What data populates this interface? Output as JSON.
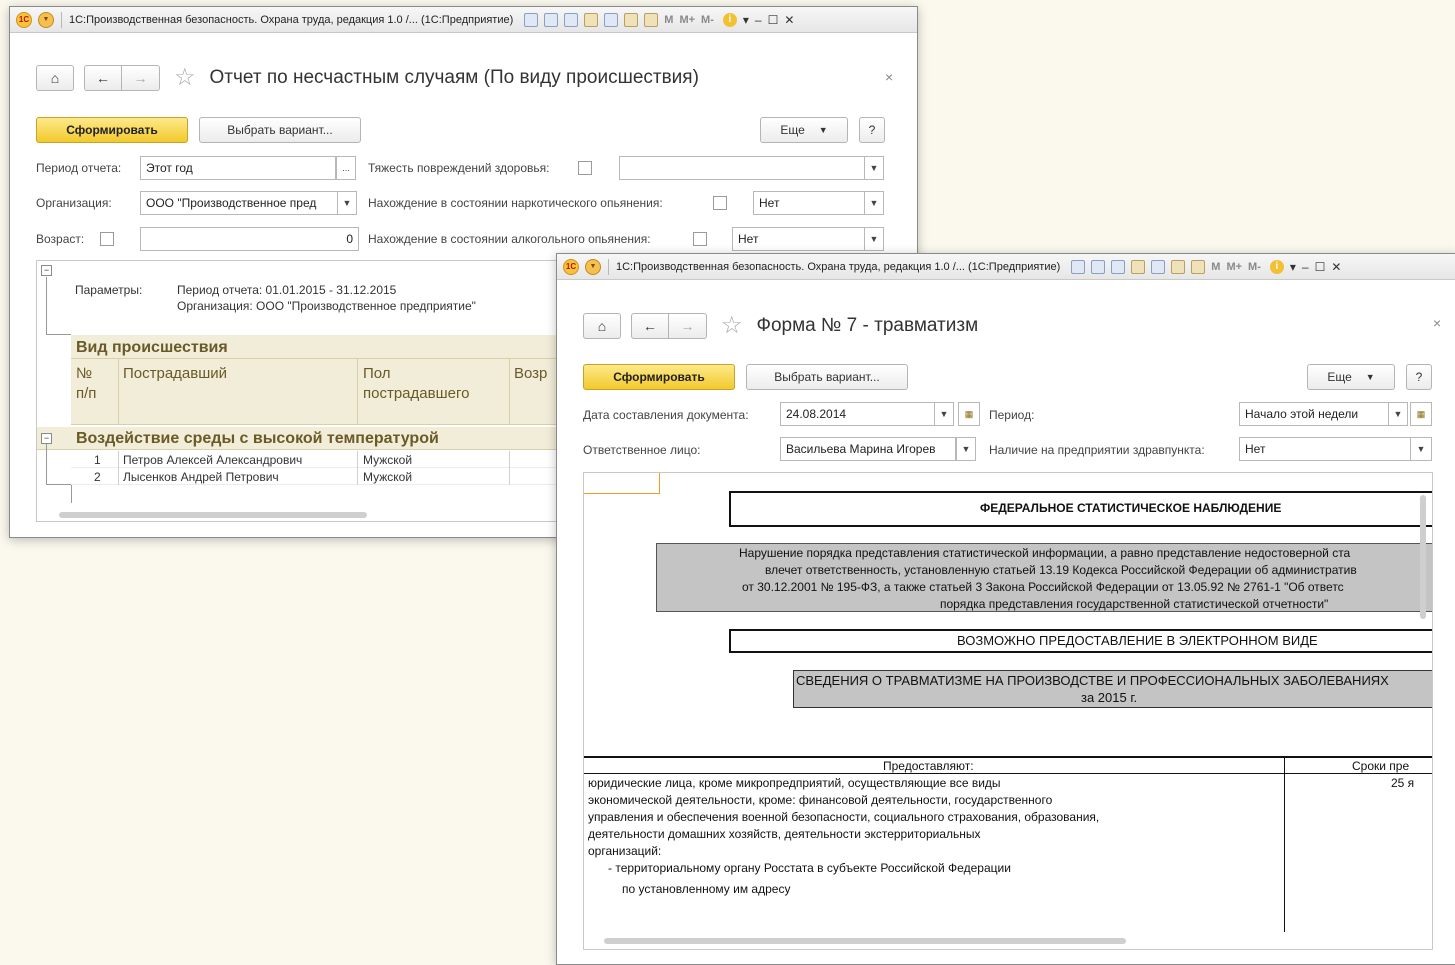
{
  "window1": {
    "title": "1С:Производственная безопасность. Охрана труда, редакция 1.0 /... (1С:Предприятие)",
    "heading": "Отчет по несчастным случаям (По виду происшествия)",
    "toolbar": {
      "generate": "Сформировать",
      "choose_variant": "Выбрать вариант...",
      "more": "Еще",
      "help": "?"
    },
    "filters": {
      "period_label": "Период отчета:",
      "period_value": "Этот год",
      "org_label": "Организация:",
      "org_value": "ООО \"Производственное пред",
      "age_label": "Возраст:",
      "age_value": "0",
      "injury_label": "Тяжесть повреждений здоровья:",
      "injury_value": "",
      "drug_label": "Нахождение в состоянии наркотического опьянения:",
      "drug_value": "Нет",
      "alcohol_label": "Нахождение в состоянии алкогольного опьянения:",
      "alcohol_value": "Нет"
    },
    "report": {
      "params_label": "Параметры:",
      "params_line1": "Период отчета: 01.01.2015 - 31.12.2015",
      "params_line2": "Организация: ООО \"Производственное предприятие\"",
      "group_header": "Вид происшествия",
      "columns": [
        "№ п/п",
        "Пострадавший",
        "Пол пострадавшего",
        "Возр"
      ],
      "col_no_line1": "№",
      "col_no_line2": "п/п",
      "col_sex_line1": "Пол",
      "col_sex_line2": "пострадавшего",
      "group_name": "Воздействие среды с высокой температурой",
      "rows": [
        {
          "num": "1",
          "name": "Петров Алексей Александрович",
          "sex": "Мужской"
        },
        {
          "num": "2",
          "name": "Лысенков Андрей Петрович",
          "sex": "Мужской"
        }
      ]
    }
  },
  "window2": {
    "title": "1С:Производственная безопасность. Охрана труда, редакция 1.0 /... (1С:Предприятие)",
    "heading": "Форма № 7 - травматизм",
    "toolbar": {
      "generate": "Сформировать",
      "choose_variant": "Выбрать вариант...",
      "more": "Еще",
      "help": "?"
    },
    "filters": {
      "date_label": "Дата составления документа:",
      "date_value": "24.08.2014",
      "period_label": "Период:",
      "period_value": "Начало этой недели",
      "person_label": "Ответственное лицо:",
      "person_value": "Васильева Марина Игорев",
      "aid_label": "Наличие на предприятии здравпункта:",
      "aid_value": "Нет"
    },
    "document": {
      "federal": "ФЕДЕРАЛЬНОЕ СТАТИСТИЧЕСКОЕ НАБЛЮДЕНИЕ",
      "warning_lines": [
        "Нарушение порядка представления статистической информации, а равно представление недостоверной ста",
        "влечет ответственность, установленную статьей 13.19 Кодекса Российской Федерации об административ",
        "от 30.12.2001 № 195-ФЗ, а также статьей 3 Закона Российской Федерации от 13.05.92 № 2761-1 \"Об ответс",
        "порядка представления государственной статистической отчетности\""
      ],
      "electronic": "ВОЗМОЖНО ПРЕДОСТАВЛЕНИЕ В ЭЛЕКТРОННОМ ВИДЕ",
      "summary_line1": "СВЕДЕНИЯ О ТРАВМАТИЗМЕ НА ПРОИЗВОДСТВЕ И ПРОФЕССИОНАЛЬНЫХ ЗАБОЛЕВАНИЯХ",
      "summary_line2": "за 2015 г.",
      "table_provide": "Предоставляют:",
      "table_terms": "Сроки пре",
      "term_value": "25 я",
      "provide_lines": [
        "юридические лица, кроме микропредприятий, осуществляющие все виды",
        "экономической деятельности, кроме: финансовой деятельности, государственного",
        "управления и обеспечения военной безопасности, социального страхования, образования,",
        "деятельности домашних хозяйств, деятельности экстерриториальных",
        "организаций:"
      ],
      "bullet_line1": "- территориальному органу Росстата в субъекте Российской Федерации",
      "bullet_line2": "по установленному им адресу"
    }
  },
  "titlebar_tools": {
    "m": "M",
    "mplus": "M+",
    "mminus": "M-"
  },
  "icons": [
    "1c-logo-icon",
    "menu-icon",
    "save-icon",
    "print-icon",
    "preview-icon",
    "favorite-icon",
    "history-icon",
    "calculator-icon",
    "calendar-icon",
    "info-icon",
    "home-icon",
    "back-icon",
    "forward-icon",
    "star-icon",
    "close-icon"
  ],
  "colors": {
    "primary_button": "#f2c92c",
    "group_header": "#f2edd8",
    "report_text": "#6a5a28",
    "background": "#fbf9ee",
    "gray_block": "#c4c4c4"
  }
}
